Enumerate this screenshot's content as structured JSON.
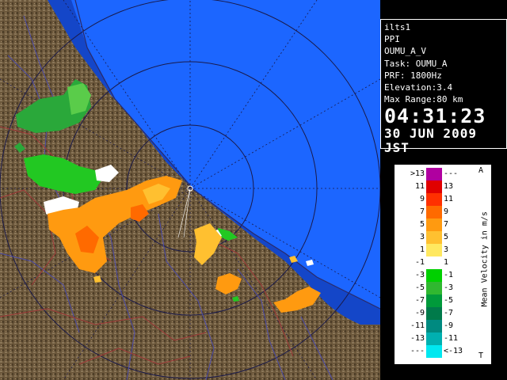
{
  "info": {
    "station": "ilts1",
    "mode": "PPI",
    "product": "OUMU_A_V",
    "task": "Task: OUMU_A",
    "prf": "PRF: 1800Hz",
    "elevation": "Elevation:3.4",
    "max_range": "Max Range:80 km",
    "time": "04:31:23",
    "date": "30 JUN 2009 JST"
  },
  "legend": {
    "title": "Mean Velocity in m/s",
    "top_marker": "A",
    "bottom_marker": "T",
    "rows": [
      {
        "left": ">13",
        "right": "---",
        "color": "#b000a0"
      },
      {
        "left": "11",
        "right": "13",
        "color": "#e00000"
      },
      {
        "left": "9",
        "right": "11",
        "color": "#ff3000"
      },
      {
        "left": "7",
        "right": "9",
        "color": "#ff6a00"
      },
      {
        "left": "5",
        "right": "7",
        "color": "#ff9a10"
      },
      {
        "left": "3",
        "right": "5",
        "color": "#ffc030"
      },
      {
        "left": "1",
        "right": "3",
        "color": "#ffe860"
      },
      {
        "left": "-1",
        "right": "1",
        "color": "#ffffff"
      },
      {
        "left": "-3",
        "right": "-1",
        "color": "#00d000"
      },
      {
        "left": "-5",
        "right": "-3",
        "color": "#30b830"
      },
      {
        "left": "-7",
        "right": "-5",
        "color": "#009a3a"
      },
      {
        "left": "-9",
        "right": "-7",
        "color": "#007a4a"
      },
      {
        "left": "-11",
        "right": "-9",
        "color": "#008a80"
      },
      {
        "left": "-13",
        "right": "-11",
        "color": "#00b0b0"
      },
      {
        "left": "---",
        "right": "<-13",
        "color": "#00e8f0"
      }
    ]
  },
  "colors": {
    "sea": "#1c66ff",
    "outer_sea": "#1446c8",
    "land": "#6e5a3c"
  }
}
